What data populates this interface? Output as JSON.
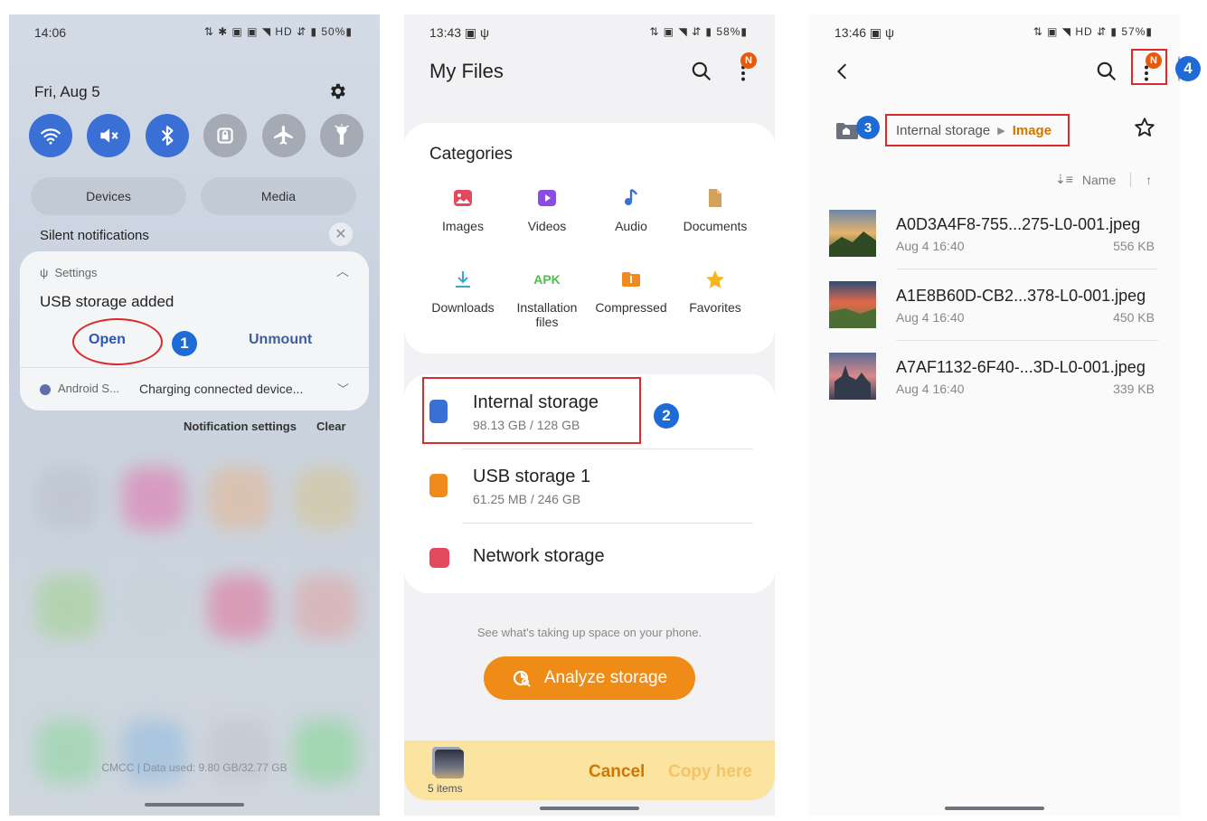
{
  "phone1": {
    "status": {
      "time": "14:06",
      "icons": "⇅ ✱ ▣ ▣ ◥ HD ⇵ ▮ 50%▮"
    },
    "date": "Fri, Aug 5",
    "toggles": [
      "wifi-icon",
      "mute-icon",
      "bluetooth-icon",
      "lock-icon",
      "airplane-icon",
      "flashlight-icon"
    ],
    "segments": {
      "devices": "Devices",
      "media": "Media"
    },
    "silent_label": "Silent notifications",
    "silent_close": "✕",
    "notification": {
      "app": "Settings",
      "usb_symbol": "ψ",
      "title": "USB storage added",
      "open_label": "Open",
      "unmount_label": "Unmount",
      "step": "1"
    },
    "notification2": {
      "app": "Android S...",
      "text": "Charging connected device..."
    },
    "notification_settings": "Notification settings",
    "clear": "Clear",
    "carrier": "CMCC | Data used: 9.80 GB/32.77 GB"
  },
  "phone2": {
    "status": {
      "time": "13:43 ▣ ψ",
      "icons": "⇅ ▣ ◥ ⇵ ▮ 58%▮"
    },
    "title": "My Files",
    "notif_badge": "N",
    "categories_title": "Categories",
    "categories": [
      {
        "label": "Images",
        "icon": "image-icon"
      },
      {
        "label": "Videos",
        "icon": "video-icon"
      },
      {
        "label": "Audio",
        "icon": "music-note-icon"
      },
      {
        "label": "Documents",
        "icon": "document-icon"
      },
      {
        "label": "Downloads",
        "icon": "download-icon"
      },
      {
        "label": "Installation files",
        "icon": "apk-icon",
        "glyph": "APK"
      },
      {
        "label": "Compressed",
        "icon": "folder-zip-icon"
      },
      {
        "label": "Favorites",
        "icon": "star-icon"
      }
    ],
    "storage": {
      "internal": {
        "name": "Internal storage",
        "sub": "98.13 GB / 128 GB"
      },
      "usb": {
        "name": "USB storage 1",
        "sub": "61.25 MB / 246 GB"
      },
      "network": {
        "name": "Network storage"
      }
    },
    "step": "2",
    "hint": "See what's taking up space on your phone.",
    "analyze_label": "Analyze storage",
    "bottom": {
      "items": "5 items",
      "cancel": "Cancel",
      "copy_here": "Copy here"
    }
  },
  "phone3": {
    "status": {
      "time": "13:46 ▣ ψ",
      "icons": "⇅ ▣ ◥ HD ⇵ ▮ 57%▮"
    },
    "notif_badge": "N",
    "step_home": "3",
    "step_menu": "4",
    "breadcrumb": {
      "root": "Internal storage",
      "separator": "▶",
      "current": "Image"
    },
    "sort": {
      "label": "Name"
    },
    "files": [
      {
        "name": "A0D3A4F8-755...275-L0-001.jpeg",
        "date": "Aug 4 16:40",
        "size": "556 KB"
      },
      {
        "name": "A1E8B60D-CB2...378-L0-001.jpeg",
        "date": "Aug 4 16:40",
        "size": "450 KB"
      },
      {
        "name": "A7AF1132-6F40-...3D-L0-001.jpeg",
        "date": "Aug 4 16:40",
        "size": "339 KB"
      }
    ]
  },
  "colors": {
    "accent_blue": "#3a6fd6",
    "highlight_red": "#d92b2b",
    "orange": "#ef8c17",
    "step_blue": "#1f6bd6"
  }
}
